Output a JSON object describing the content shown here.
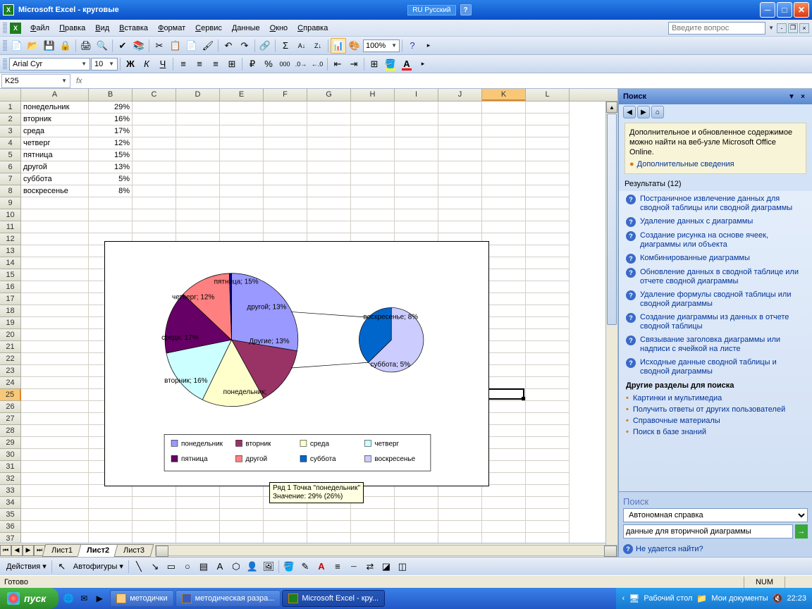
{
  "title": "Microsoft Excel - круговые",
  "lang_indicator": "RU Русский",
  "menu": [
    "Файл",
    "Правка",
    "Вид",
    "Вставка",
    "Формат",
    "Сервис",
    "Данные",
    "Окно",
    "Справка"
  ],
  "ask_placeholder": "Введите вопрос",
  "font_name": "Arial Cyr",
  "font_size": "10",
  "zoom": "100%",
  "name_box": "K25",
  "formula": "",
  "columns": [
    "A",
    "B",
    "C",
    "D",
    "E",
    "F",
    "G",
    "H",
    "I",
    "J",
    "K",
    "L"
  ],
  "active_col_idx": 10,
  "active_row": 25,
  "cells": [
    {
      "r": 1,
      "c": 0,
      "v": "понедельник"
    },
    {
      "r": 1,
      "c": 1,
      "v": "29%",
      "align": "r"
    },
    {
      "r": 2,
      "c": 0,
      "v": "вторник"
    },
    {
      "r": 2,
      "c": 1,
      "v": "16%",
      "align": "r"
    },
    {
      "r": 3,
      "c": 0,
      "v": "среда"
    },
    {
      "r": 3,
      "c": 1,
      "v": "17%",
      "align": "r"
    },
    {
      "r": 4,
      "c": 0,
      "v": "четверг"
    },
    {
      "r": 4,
      "c": 1,
      "v": "12%",
      "align": "r"
    },
    {
      "r": 5,
      "c": 0,
      "v": "пятница"
    },
    {
      "r": 5,
      "c": 1,
      "v": "15%",
      "align": "r"
    },
    {
      "r": 6,
      "c": 0,
      "v": "другой"
    },
    {
      "r": 6,
      "c": 1,
      "v": "13%",
      "align": "r"
    },
    {
      "r": 7,
      "c": 0,
      "v": "суббота"
    },
    {
      "r": 7,
      "c": 1,
      "v": "5%",
      "align": "r"
    },
    {
      "r": 8,
      "c": 0,
      "v": "воскресенье"
    },
    {
      "r": 8,
      "c": 1,
      "v": "8%",
      "align": "r"
    }
  ],
  "sheet_tabs": [
    "Лист1",
    "Лист2",
    "Лист3"
  ],
  "active_sheet": 1,
  "tooltip": {
    "line1": "Ряд 1 Точка \"понедельник\"",
    "line2": "Значение: 29% (26%)"
  },
  "chart_data": {
    "type": "pie",
    "subtype": "pie-of-pie",
    "series": [
      {
        "name": "Ряд 1",
        "values": [
          29,
          16,
          17,
          12,
          15,
          13,
          5,
          8
        ]
      }
    ],
    "categories": [
      "понедельник",
      "вторник",
      "среда",
      "четверг",
      "пятница",
      "другой",
      "суббота",
      "воскресенье"
    ],
    "main_pie_labels": [
      {
        "text": "понедельник; 29%",
        "color": "#9999FF"
      },
      {
        "text": "вторник; 16%",
        "color": "#993366"
      },
      {
        "text": "среда; 17%",
        "color": "#FFFFCC"
      },
      {
        "text": "четверг; 12%",
        "color": "#CCFFFF"
      },
      {
        "text": "пятница; 15%",
        "color": "#660066"
      },
      {
        "text": "другой; 13%",
        "color": "#FF8080"
      },
      {
        "text": "Другие; 13%",
        "color": "#000080"
      }
    ],
    "secondary_pie_labels": [
      {
        "text": "суббота; 5%",
        "color": "#0066CC"
      },
      {
        "text": "воскресенье; 8%",
        "color": "#CCCCFF"
      }
    ],
    "legend": [
      "понедельник",
      "вторник",
      "среда",
      "четверг",
      "пятница",
      "другой",
      "суббота",
      "воскресенье"
    ],
    "legend_position": "bottom"
  },
  "taskpane": {
    "title": "Поиск",
    "info": "Дополнительное и обновленное содержимое можно найти на веб-узле Microsoft Office Online.",
    "info_link": "Дополнительные сведения",
    "results_header": "Результаты (12)",
    "results": [
      "Постраничное извлечение данных для сводной таблицы или сводной диаграммы",
      "Удаление данных с диаграммы",
      "Создание рисунка на основе ячеек, диаграммы или объекта",
      "Комбинированные диаграммы",
      "Обновление данных в сводной таблице или отчете сводной диаграммы",
      "Удаление формулы сводной таблицы или сводной диаграммы",
      "Создание диаграммы из данных в отчете сводной таблицы",
      "Связывание заголовка диаграммы или надписи с ячейкой на листе",
      "Исходные данные сводной таблицы и сводной диаграммы"
    ],
    "other_sections_h": "Другие разделы для поиска",
    "other_sections": [
      "Картинки и мультимедиа",
      "Получить ответы от других пользователей",
      "Справочные материалы",
      "Поиск в базе знаний"
    ],
    "search_label": "Поиск",
    "search_scope": "Автономная справка",
    "search_value": "данные для вторичной диаграммы",
    "cant_find": "Не удается найти?"
  },
  "draw_toolbar": {
    "actions": "Действия",
    "autoshapes": "Автофигуры"
  },
  "status": {
    "ready": "Готово",
    "num": "NUM"
  },
  "taskbar": {
    "start": "пуск",
    "tasks": [
      {
        "label": "методички",
        "icon": "folder"
      },
      {
        "label": "методическая разра...",
        "icon": "word"
      },
      {
        "label": "Microsoft Excel - кру...",
        "icon": "excel",
        "active": true
      }
    ],
    "desktop": "Рабочий стол",
    "docs": "Мои документы",
    "clock": "22:23"
  }
}
